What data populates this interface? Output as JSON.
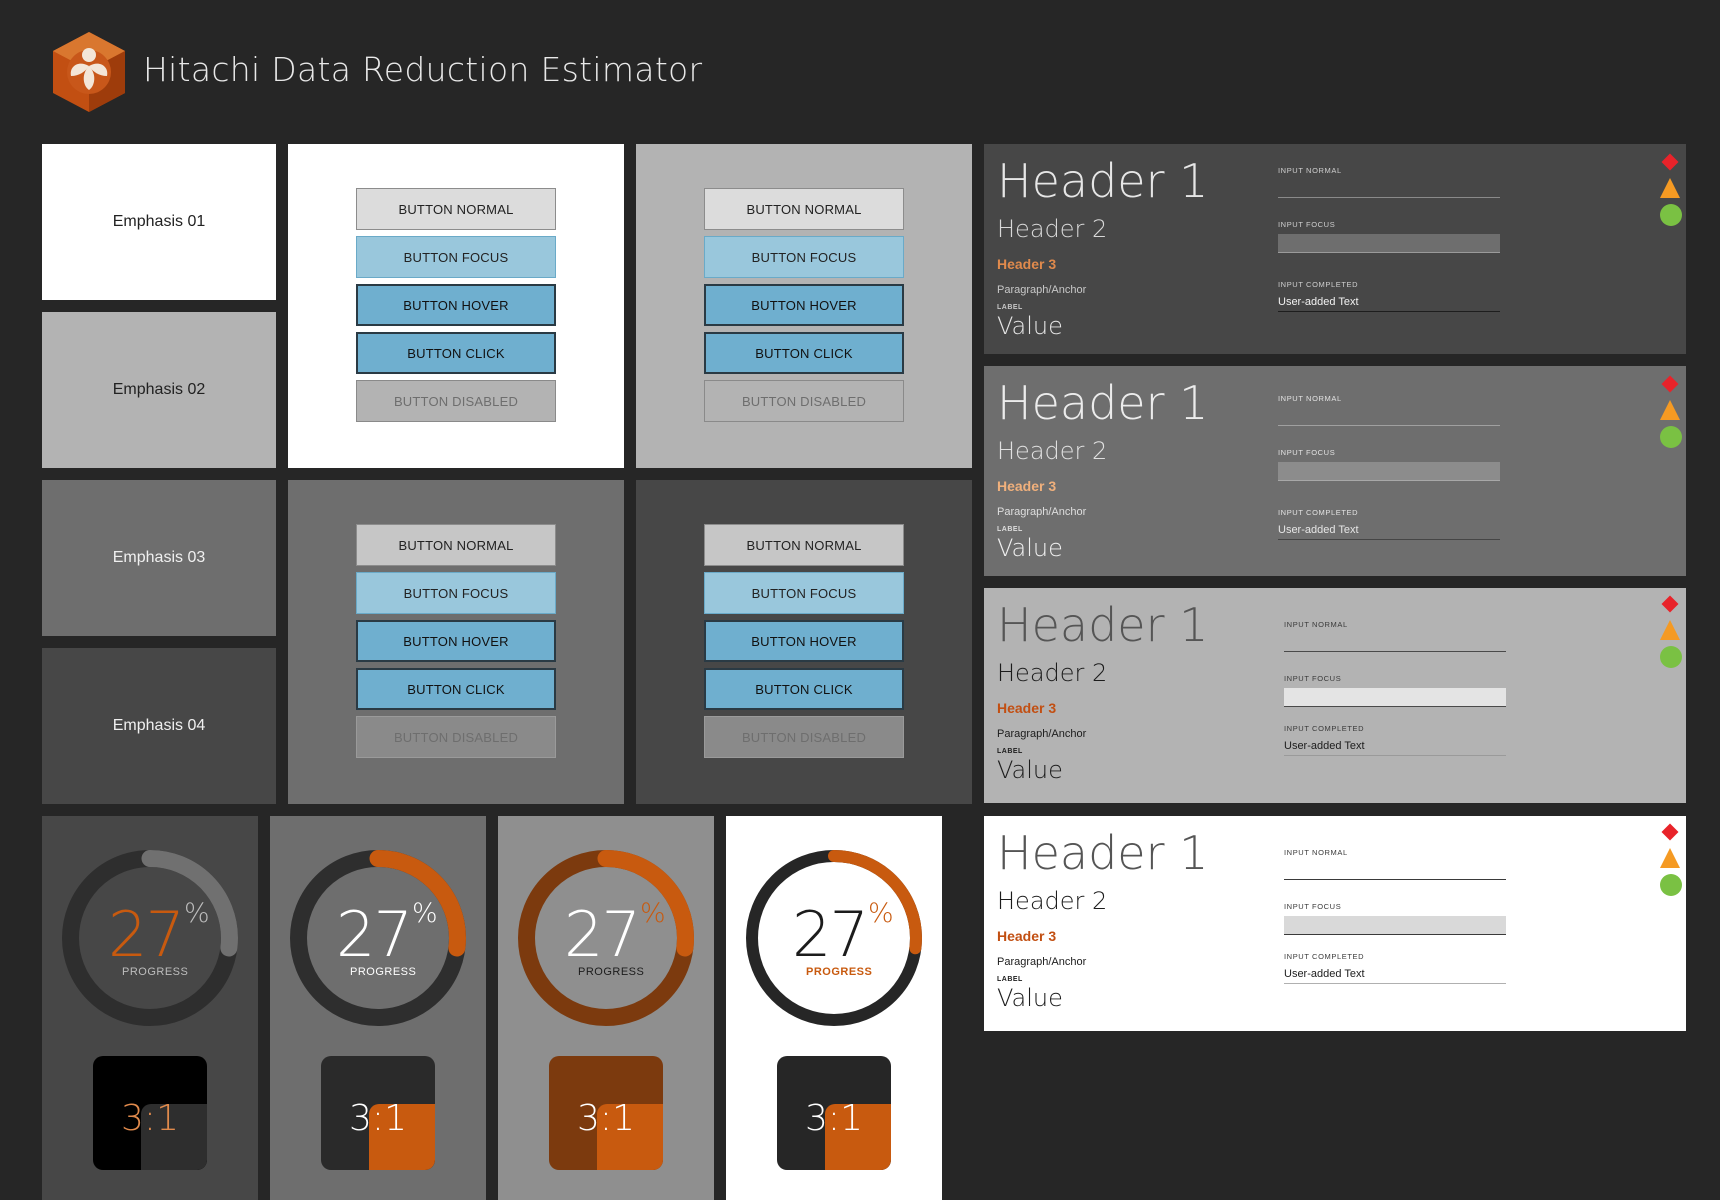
{
  "app": {
    "title": "Hitachi Data Reduction Estimator"
  },
  "emphasis": [
    {
      "label": "Emphasis 01"
    },
    {
      "label": "Emphasis 02"
    },
    {
      "label": "Emphasis 03"
    },
    {
      "label": "Emphasis 04"
    }
  ],
  "buttons": {
    "normal": "BUTTON NORMAL",
    "focus": "BUTTON FOCUS",
    "hover": "BUTTON HOVER",
    "click": "BUTTON CLICK",
    "disabled": "BUTTON DISABLED"
  },
  "type_specimen": {
    "h1": "Header 1",
    "h2": "Header 2",
    "h3": "Header 3",
    "paragraph": "Paragraph/Anchor",
    "label": "LABEL",
    "value": "Value",
    "input_normal": "INPUT NORMAL",
    "input_focus": "INPUT FOCUS",
    "input_completed": "INPUT COMPLETED",
    "user_text": "User-added Text"
  },
  "progress": {
    "value": "27",
    "fraction": 0.27,
    "unit": "%",
    "label": "PROGRESS",
    "ratio": "3:1"
  },
  "colors": {
    "background": "#262626",
    "accent_orange": "#c85a0f",
    "error_red": "#e8232a",
    "warning_orange": "#f59a23",
    "success_green": "#7ac143",
    "button_blue": "#6fafcf",
    "button_focus": "#99c7dc"
  },
  "icons": [
    "hitachi-logo-cube-icon",
    "error-diamond-icon",
    "warning-triangle-icon",
    "success-circle-icon"
  ]
}
